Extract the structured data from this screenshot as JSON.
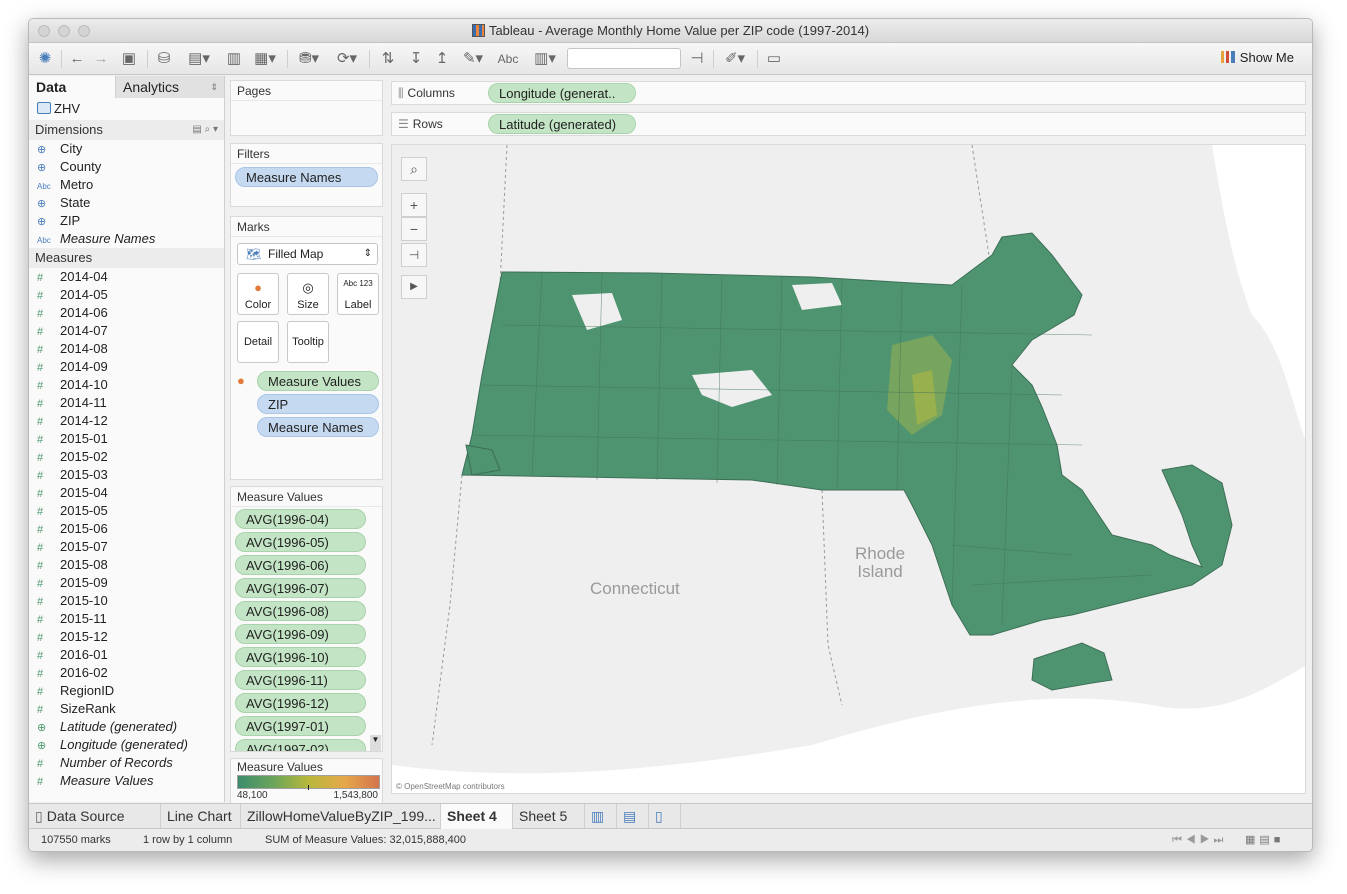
{
  "window": {
    "title": "Tableau - Average Monthly Home Value per ZIP code (1997-2014)"
  },
  "toolbar": {
    "show_me": "Show Me",
    "abc_label": "Abc"
  },
  "data_pane": {
    "tabs": [
      "Data",
      "Analytics"
    ],
    "datasource": "ZHV",
    "dimensions_header": "Dimensions",
    "dimensions": [
      {
        "name": "City",
        "icon": "globe"
      },
      {
        "name": "County",
        "icon": "globe"
      },
      {
        "name": "Metro",
        "icon": "abc"
      },
      {
        "name": "State",
        "icon": "globe"
      },
      {
        "name": "ZIP",
        "icon": "globe"
      },
      {
        "name": "Measure Names",
        "icon": "abc"
      }
    ],
    "measures_header": "Measures",
    "measures": [
      "2014-04",
      "2014-05",
      "2014-06",
      "2014-07",
      "2014-08",
      "2014-09",
      "2014-10",
      "2014-11",
      "2014-12",
      "2015-01",
      "2015-02",
      "2015-03",
      "2015-04",
      "2015-05",
      "2015-06",
      "2015-07",
      "2015-08",
      "2015-09",
      "2015-10",
      "2015-11",
      "2015-12",
      "2016-01",
      "2016-02",
      "RegionID",
      "SizeRank",
      "Latitude (generated)",
      "Longitude (generated)",
      "Number of Records",
      "Measure Values"
    ]
  },
  "cards": {
    "pages_title": "Pages",
    "filters_title": "Filters",
    "filter_pill": "Measure Names",
    "marks_title": "Marks",
    "mark_type": "Filled Map",
    "mark_buttons": [
      "Color",
      "Size",
      "Label",
      "Detail",
      "Tooltip"
    ],
    "label_icon_text": "Abc 123",
    "mark_pills": [
      "Measure Values",
      "ZIP",
      "Measure Names"
    ],
    "measure_values_title": "Measure Values",
    "measure_values": [
      "AVG(1996-04)",
      "AVG(1996-05)",
      "AVG(1996-06)",
      "AVG(1996-07)",
      "AVG(1996-08)",
      "AVG(1996-09)",
      "AVG(1996-10)",
      "AVG(1996-11)",
      "AVG(1996-12)",
      "AVG(1997-01)",
      "AVG(1997-02)"
    ],
    "legend_title": "Measure Values",
    "legend_min": "48,100",
    "legend_max": "1,543,800"
  },
  "shelves": {
    "columns_label": "Columns",
    "columns_pill": "Longitude (generat..",
    "rows_label": "Rows",
    "rows_pill": "Latitude (generated)"
  },
  "map": {
    "labels": [
      "Connecticut",
      "Rhode\nIsland"
    ],
    "attribution": "© OpenStreetMap contributors",
    "fill_color": "#4d9a6e",
    "highlight_color": "#8caa4a"
  },
  "sheet_tabs": {
    "data_source": "Data Source",
    "tabs": [
      "Line Chart",
      "ZillowHomeValueByZIP_199...",
      "Sheet 4",
      "Sheet 5"
    ],
    "active": "Sheet 4"
  },
  "status": {
    "marks": "107550 marks",
    "dims": "1 row by 1 column",
    "sum": "SUM of Measure Values: 32,015,888,400"
  }
}
